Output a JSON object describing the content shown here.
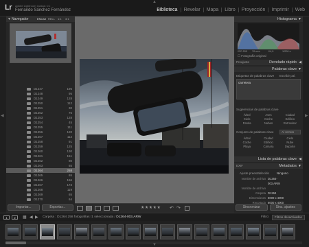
{
  "app": {
    "logo": "Lr",
    "brand_line1": "Adobe Lightroom Classic CC",
    "brand_line2": "Fernando Sánchez Fernández"
  },
  "modules": [
    "Biblioteca",
    "Revelar",
    "Mapa",
    "Libro",
    "Proyección",
    "Imprimir",
    "Web"
  ],
  "active_module": "Biblioteca",
  "navigator": {
    "title": "Navegador",
    "options": [
      "ENCAJ",
      "RELL",
      "1:1",
      "3:1"
    ]
  },
  "folders": [
    {
      "name": "D1247",
      "count": "195"
    },
    {
      "name": "D1248",
      "count": "95"
    },
    {
      "name": "D1249",
      "count": "128"
    },
    {
      "name": "D1250",
      "count": "112"
    },
    {
      "name": "D1251",
      "count": "30"
    },
    {
      "name": "D1252",
      "count": "75"
    },
    {
      "name": "D1253",
      "count": "128"
    },
    {
      "name": "D1254",
      "count": "45"
    },
    {
      "name": "D1255",
      "count": "111"
    },
    {
      "name": "D1256",
      "count": "120"
    },
    {
      "name": "D1257",
      "count": "112"
    },
    {
      "name": "D1258",
      "count": "91"
    },
    {
      "name": "D1259",
      "count": "125"
    },
    {
      "name": "D1260",
      "count": "130"
    },
    {
      "name": "D1261",
      "count": "151"
    },
    {
      "name": "D1262",
      "count": "80"
    },
    {
      "name": "D1263",
      "count": "65"
    },
    {
      "name": "D1264",
      "count": "258"
    },
    {
      "name": "D1265",
      "count": "65"
    },
    {
      "name": "D1266",
      "count": "156"
    },
    {
      "name": "D1267",
      "count": "173"
    },
    {
      "name": "D1268",
      "count": "119"
    },
    {
      "name": "D1269",
      "count": "65"
    },
    {
      "name": "D1270",
      "count": "64"
    }
  ],
  "selected_folder_index": 17,
  "left_buttons": [
    "Importar...",
    "Exportar..."
  ],
  "right_buttons": [
    "Sincronizar",
    "Sinc. ajustes"
  ],
  "histogram": {
    "title": "Histograma",
    "info": [
      "ISO 200",
      "70 mm",
      "f/4,0",
      "1/200 s"
    ],
    "original_label": "Fotografía original"
  },
  "quick_develop": {
    "preset": "Preajuste",
    "title": "Revelado rápido"
  },
  "keywords": {
    "title": "Palabras clave",
    "tags_label": "Etiquetas de palabras clave",
    "tags_mode": "Escribir pal.",
    "current": "carretera",
    "suggestions_label": "Sugerencias de palabras clave",
    "suggestions": [
      "Árbol",
      "Aves",
      "Ciudad",
      "Cielo",
      "Coche",
      "Edificio",
      "Farola",
      "Nubes",
      "Retrovisor"
    ],
    "set_label": "Conjunto de palabras clave",
    "set_value": "Al retrato",
    "set_items": [
      "Árbol",
      "Ciudad",
      "Cielo",
      "Coche",
      "Edificio",
      "Nube",
      "Playa",
      "Cámara",
      "Deporte"
    ],
    "list_title": "Lista de palabras clave"
  },
  "metadata": {
    "preset": "EXIF",
    "title": "Metadatos",
    "preset_label": "Ajuste preestablecido",
    "preset_value": "Ninguno",
    "rows": [
      {
        "key": "Nombre de archivo",
        "value": "D1264-"
      },
      {
        "key": "",
        "value": "003.ARW"
      },
      {
        "key": "Nombre de archivo",
        "value": ""
      },
      {
        "key": "Carpeta",
        "value": "D1264"
      },
      {
        "key": "Dimensiones",
        "value": "6000 x 4000"
      },
      {
        "key": "Recortado",
        "value": "6000 x 4000"
      }
    ]
  },
  "filmstrip_bar": {
    "page1": "1",
    "page2": "2",
    "folder": "Carpeta : D1264",
    "count": "258 fotografías /1 seleccionada /",
    "current_file": "D1264-003.ARW",
    "filter_label": "Filtro:",
    "filter_value": "Filtros desactivados"
  },
  "filmstrip_thumbs": 17,
  "selected_thumb_index": 2
}
